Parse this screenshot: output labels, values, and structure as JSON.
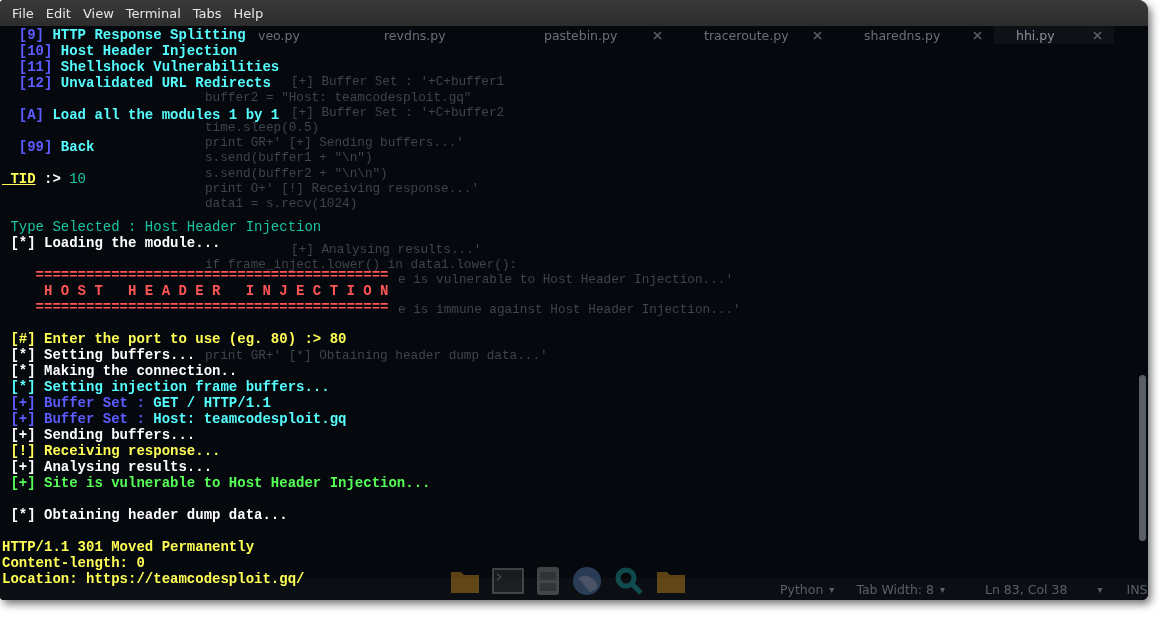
{
  "menu": [
    "File",
    "Edit",
    "View",
    "Terminal",
    "Tabs",
    "Help"
  ],
  "editor_tabs": [
    {
      "label": "veo.py",
      "selected": false,
      "closable": false
    },
    {
      "label": "revdns.py",
      "selected": false,
      "closable": false
    },
    {
      "label": "pastebin.py",
      "selected": false,
      "closable": true
    },
    {
      "label": "traceroute.py",
      "selected": false,
      "closable": true
    },
    {
      "label": "sharedns.py",
      "selected": false,
      "closable": true
    },
    {
      "label": "hhi.py",
      "selected": true,
      "closable": true
    }
  ],
  "code_lines": [
    {
      "kind": "blank"
    },
    {
      "kind": "blank"
    },
    {
      "kind": "fragment",
      "text": "[+] Buffer Set : '+C+buffer1"
    },
    {
      "kind": "statement",
      "text": "buffer2 = \"Host: teamcodesploit.gq\""
    },
    {
      "kind": "fragment",
      "text": "[+] Buffer Set : '+C+buffer2"
    },
    {
      "kind": "statement",
      "text": "time.sleep(0.5)"
    },
    {
      "kind": "statement",
      "text": "print GR+' [+] Sending buffers...'"
    },
    {
      "kind": "statement",
      "text": "s.send(buffer1 + \"\\n\")"
    },
    {
      "kind": "statement",
      "text": "s.send(buffer2 + \"\\n\\n\")"
    },
    {
      "kind": "statement",
      "text": "print O+' [!] Receiving response...'"
    },
    {
      "kind": "statement",
      "text": "data1 = s.recv(1024)"
    },
    {
      "kind": "blank"
    },
    {
      "kind": "blank"
    },
    {
      "kind": "fragment",
      "text": "[+] Analysing results...'"
    },
    {
      "kind": "statement",
      "text": "if frame_inject.lower() in data1.lower():"
    },
    {
      "kind": "tail",
      "text": "e is vulnerable to Host Header Injection...'"
    },
    {
      "kind": "blank"
    },
    {
      "kind": "tail",
      "text": "e is immune against Host Header Injection...'"
    },
    {
      "kind": "blank"
    },
    {
      "kind": "blank"
    },
    {
      "kind": "statement",
      "text": "print GR+' [*] Obtaining header dump data...'"
    }
  ],
  "terminal_lines": [
    {
      "kind": "output",
      "segments": [
        {
          "text": "  [9]",
          "color": "#5c5cff",
          "bold": true
        },
        {
          "text": " HTTP Response Splitting",
          "color": "#55ffff",
          "bold": true
        }
      ]
    },
    {
      "kind": "output",
      "segments": [
        {
          "text": "  [10]",
          "color": "#5c5cff",
          "bold": true
        },
        {
          "text": " Host Header Injection",
          "color": "#55ffff",
          "bold": true
        }
      ]
    },
    {
      "kind": "output",
      "segments": [
        {
          "text": "  [11]",
          "color": "#5c5cff",
          "bold": true
        },
        {
          "text": " Shellshock Vulnerabilities",
          "color": "#55ffff",
          "bold": true
        }
      ]
    },
    {
      "kind": "output",
      "segments": [
        {
          "text": "  [12]",
          "color": "#5c5cff",
          "bold": true
        },
        {
          "text": " Unvalidated URL Redirects",
          "color": "#55ffff",
          "bold": true
        }
      ]
    },
    {
      "kind": "blank"
    },
    {
      "kind": "output",
      "segments": [
        {
          "text": "  [A]",
          "color": "#5c5cff",
          "bold": true
        },
        {
          "text": " Load all the modules 1 by 1",
          "color": "#55ffff",
          "bold": true
        }
      ]
    },
    {
      "kind": "blank"
    },
    {
      "kind": "output",
      "segments": [
        {
          "text": "  [99]",
          "color": "#5c5cff",
          "bold": true
        },
        {
          "text": " Back",
          "color": "#55ffff",
          "bold": true
        }
      ]
    },
    {
      "kind": "blank"
    },
    {
      "kind": "output",
      "segments": [
        {
          "text": " TID",
          "color": "#ffff55",
          "bold": true,
          "underline": true
        },
        {
          "text": " :> ",
          "color": "#ffffff",
          "bold": true
        },
        {
          "text": "10",
          "color": "#17c3a3",
          "bold": false
        }
      ]
    },
    {
      "kind": "blank"
    },
    {
      "kind": "blank"
    },
    {
      "kind": "output",
      "segments": [
        {
          "text": " Type Selected : Host Header Injection",
          "color": "#17c3a3",
          "bold": false
        }
      ]
    },
    {
      "kind": "output",
      "segments": [
        {
          "text": " [*] Loading the module...",
          "color": "#ffffff",
          "bold": true
        }
      ]
    },
    {
      "kind": "blank"
    },
    {
      "kind": "output",
      "segments": [
        {
          "text": "    ==========================================",
          "color": "#ff5555",
          "bold": true
        }
      ]
    },
    {
      "kind": "output",
      "segments": [
        {
          "text": "     H O S T   H E A D E R   I N J E C T I O N",
          "color": "#ff5555",
          "bold": true
        }
      ]
    },
    {
      "kind": "output",
      "segments": [
        {
          "text": "    ==========================================",
          "color": "#ff5555",
          "bold": true
        }
      ]
    },
    {
      "kind": "blank"
    },
    {
      "kind": "output",
      "segments": [
        {
          "text": " [#] Enter the port to use (eg. 80) :> 80",
          "color": "#ffff55",
          "bold": true
        }
      ]
    },
    {
      "kind": "output",
      "segments": [
        {
          "text": " [*] Setting buffers...",
          "color": "#ffffff",
          "bold": true
        }
      ]
    },
    {
      "kind": "output",
      "segments": [
        {
          "text": " [*] Making the connection..",
          "color": "#ffffff",
          "bold": true
        }
      ]
    },
    {
      "kind": "output",
      "segments": [
        {
          "text": " [*] Setting injection frame buffers...",
          "color": "#55ffff",
          "bold": true
        }
      ]
    },
    {
      "kind": "output",
      "segments": [
        {
          "text": " [+] Buffer Set :",
          "color": "#5c5cff",
          "bold": true
        },
        {
          "text": " GET / HTTP/1.1",
          "color": "#55ffff",
          "bold": true
        }
      ]
    },
    {
      "kind": "output",
      "segments": [
        {
          "text": " [+] Buffer Set :",
          "color": "#5c5cff",
          "bold": true
        },
        {
          "text": " Host: teamcodesploit.gq",
          "color": "#55ffff",
          "bold": true
        }
      ]
    },
    {
      "kind": "output",
      "segments": [
        {
          "text": " [+] Sending buffers...",
          "color": "#ffffff",
          "bold": true
        }
      ]
    },
    {
      "kind": "output",
      "segments": [
        {
          "text": " [!] Receiving response...",
          "color": "#ffff55",
          "bold": true
        }
      ]
    },
    {
      "kind": "output",
      "segments": [
        {
          "text": " [+] Analysing results...",
          "color": "#ffffff",
          "bold": true
        }
      ]
    },
    {
      "kind": "output",
      "segments": [
        {
          "text": " [+] Site is vulnerable to Host Header Injection...",
          "color": "#55ff55",
          "bold": true
        }
      ]
    },
    {
      "kind": "blank"
    },
    {
      "kind": "output",
      "segments": [
        {
          "text": " [*] Obtaining header dump data...",
          "color": "#ffffff",
          "bold": true
        }
      ]
    },
    {
      "kind": "blank"
    },
    {
      "kind": "output",
      "segments": [
        {
          "text": "HTTP/1.1 301 Moved Permanently",
          "color": "#ffff55",
          "bold": true
        }
      ]
    },
    {
      "kind": "output",
      "segments": [
        {
          "text": "Content-length: 0",
          "color": "#ffff55",
          "bold": true
        }
      ]
    },
    {
      "kind": "output",
      "segments": [
        {
          "text": "Location: https://teamcodesploit.gq/",
          "color": "#ffff55",
          "bold": true
        }
      ]
    }
  ],
  "status_bar": {
    "language": "Python",
    "tab_width": "Tab Width: 8",
    "position": "Ln 83, Col 38",
    "position_caret": "▾",
    "mode": "INS",
    "caret": "▾"
  }
}
